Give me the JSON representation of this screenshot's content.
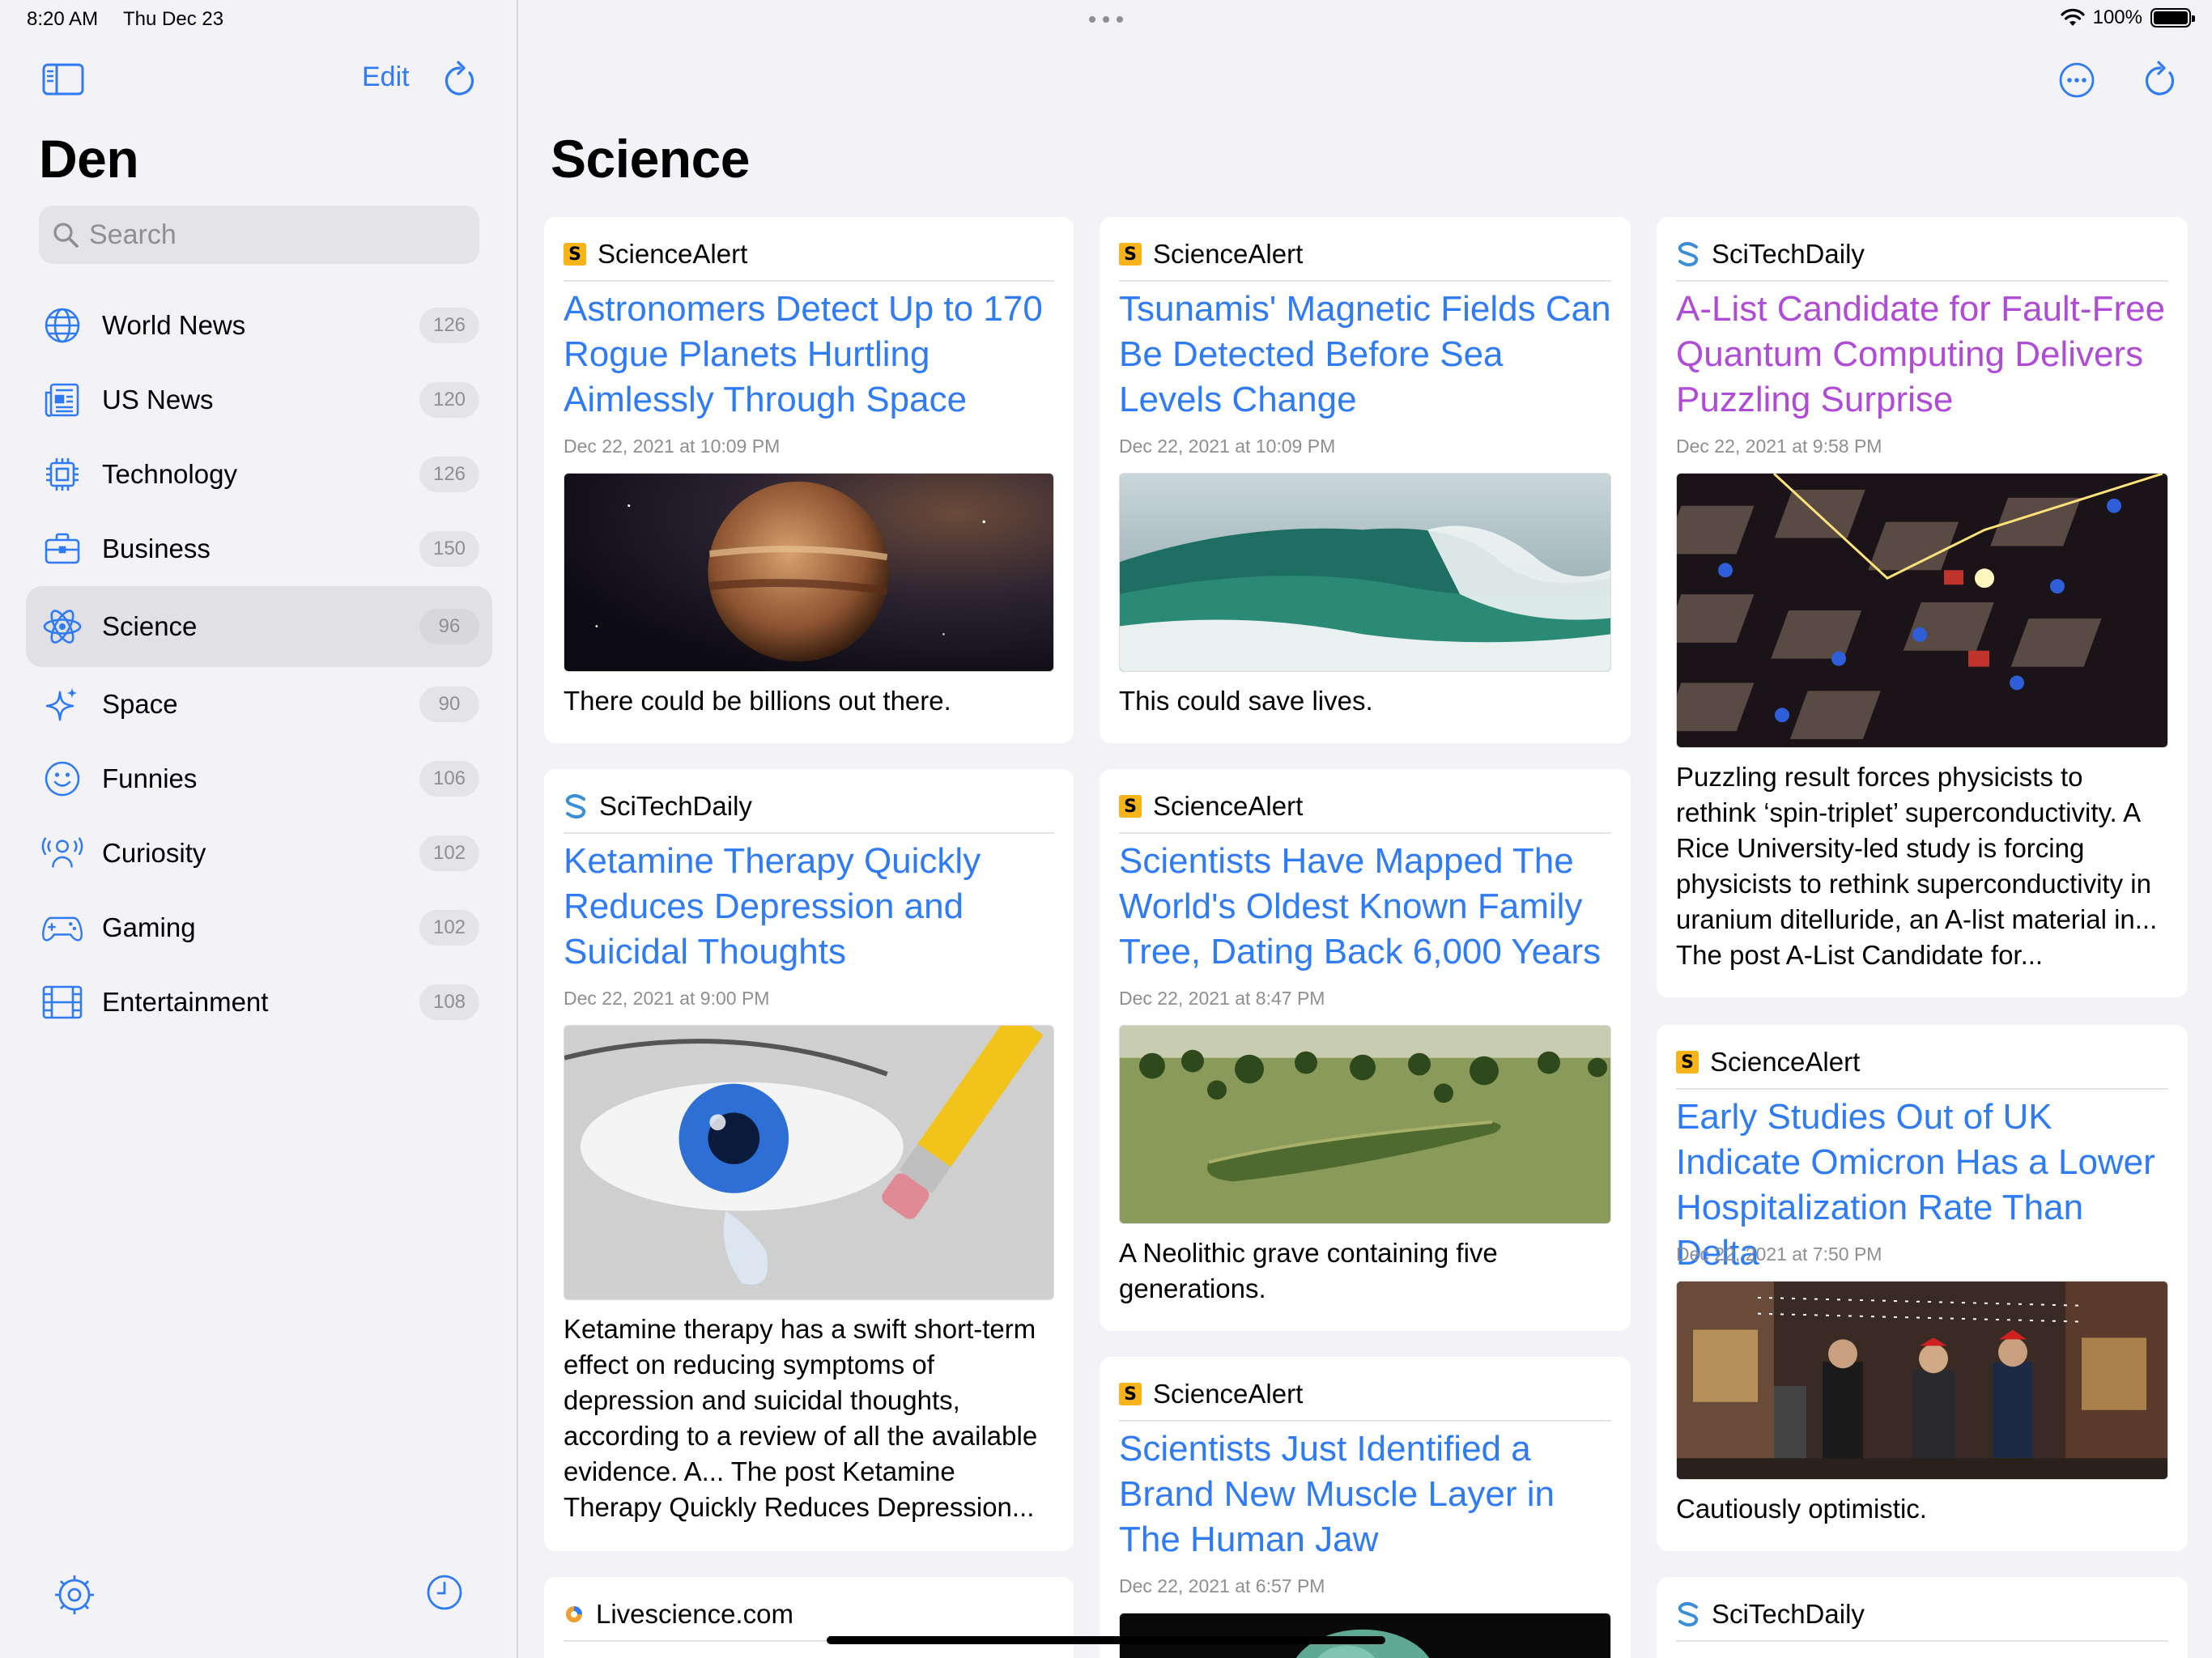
{
  "status_bar": {
    "time": "8:20 AM",
    "date": "Thu Dec 23",
    "battery": "100%"
  },
  "sidebar": {
    "edit_label": "Edit",
    "title": "Den",
    "search_placeholder": "Search",
    "categories": [
      {
        "label": "World News",
        "count": "126",
        "icon": "globe-icon"
      },
      {
        "label": "US News",
        "count": "120",
        "icon": "newspaper-icon"
      },
      {
        "label": "Technology",
        "count": "126",
        "icon": "cpu-icon"
      },
      {
        "label": "Business",
        "count": "150",
        "icon": "briefcase-icon"
      },
      {
        "label": "Science",
        "count": "96",
        "icon": "atom-icon"
      },
      {
        "label": "Space",
        "count": "90",
        "icon": "sparkles-icon"
      },
      {
        "label": "Funnies",
        "count": "106",
        "icon": "smiley-icon"
      },
      {
        "label": "Curiosity",
        "count": "102",
        "icon": "person-waves-icon"
      },
      {
        "label": "Gaming",
        "count": "102",
        "icon": "gamecontroller-icon"
      },
      {
        "label": "Entertainment",
        "count": "108",
        "icon": "film-icon"
      }
    ]
  },
  "main": {
    "title": "Science",
    "cards": [
      {
        "source": "ScienceAlert",
        "headline": "Astronomers Detect Up to 170 Rogue Planets Hurtling Aimlessly Through Space",
        "time": "Dec 22, 2021 at 10:09 PM",
        "summary": "There could be billions out there."
      },
      {
        "source": "ScienceAlert",
        "headline": "Tsunamis' Magnetic Fields Can Be Detected Before Sea Levels Change",
        "time": "Dec 22, 2021 at 10:09 PM",
        "summary": "This could save lives."
      },
      {
        "source": "SciTechDaily",
        "headline": "A-List Candidate for Fault-Free Quantum Computing Delivers Puzzling Surprise",
        "time": "Dec 22, 2021 at 9:58 PM",
        "summary": "Puzzling result forces physicists to rethink ‘spin-triplet’ superconductivity. A Rice University-led study is forcing physicists to rethink superconductivity in uranium ditelluride, an A-list material in... The post A-List Candidate for..."
      },
      {
        "source": "SciTechDaily",
        "headline": "Ketamine Therapy Quickly Reduces Depression and Suicidal Thoughts",
        "time": "Dec 22, 2021 at 9:00 PM",
        "summary": "Ketamine therapy has a swift short-term effect on reducing symptoms of depression and suicidal thoughts, according to a review of all the available evidence. A... The post Ketamine Therapy Quickly Reduces Depression..."
      },
      {
        "source": "ScienceAlert",
        "headline": "Scientists Have Mapped The World's Oldest Known Family Tree, Dating Back 6,000 Years",
        "time": "Dec 22, 2021 at 8:47 PM",
        "summary": "A Neolithic grave containing five generations."
      },
      {
        "source": "ScienceAlert",
        "headline": "Early Studies Out of UK Indicate Omicron Has a Lower Hospitalization Rate Than Delta",
        "time": "Dec 22, 2021 at 7:50 PM",
        "summary": "Cautiously optimistic."
      },
      {
        "source": "ScienceAlert",
        "headline": "Scientists Just Identified a Brand New Muscle Layer in The Human Jaw",
        "time": "Dec 22, 2021 at 6:57 PM"
      },
      {
        "source": "Livescience.com"
      },
      {
        "source": "SciTechDaily"
      }
    ]
  },
  "colors": {
    "accent": "#2f7bf6",
    "visited": "#b04bd8",
    "science_alert": "#f6b31a"
  }
}
